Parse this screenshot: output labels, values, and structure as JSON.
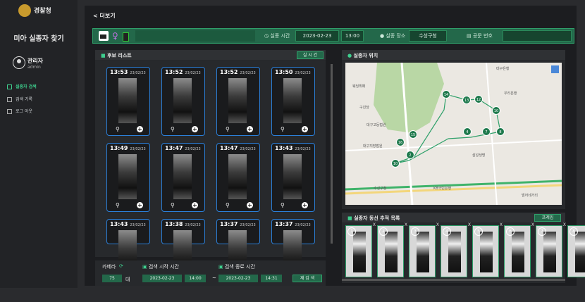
{
  "sidebar": {
    "logo_text": "경찰청",
    "app_title": "미아 실종자 찾기",
    "user": {
      "name": "관리자",
      "role": "admin"
    },
    "nav": [
      {
        "label": "실종자 검색",
        "active": true
      },
      {
        "label": "검색 기록",
        "active": false
      },
      {
        "label": "로그 아웃",
        "active": false
      }
    ]
  },
  "header": {
    "back": "< 더보기"
  },
  "topbar": {
    "time_label": "실종 시간",
    "date": "2023-02-23",
    "time": "13:00",
    "place_label": "실종 장소",
    "place": "수성구청",
    "doc_label": "공문 번호",
    "doc_value": ""
  },
  "candidates": {
    "title": "후보 리스트",
    "button": "실 시 간",
    "cards": [
      {
        "time": "13:53",
        "date": "23/02/23"
      },
      {
        "time": "13:52",
        "date": "23/02/23"
      },
      {
        "time": "13:52",
        "date": "23/02/23"
      },
      {
        "time": "13:50",
        "date": "23/02/23"
      },
      {
        "time": "13:49",
        "date": "23/02/23"
      },
      {
        "time": "13:47",
        "date": "23/02/23"
      },
      {
        "time": "13:47",
        "date": "23/02/23"
      },
      {
        "time": "13:43",
        "date": "23/02/23"
      },
      {
        "time": "13:43",
        "date": "23/02/23"
      },
      {
        "time": "13:38",
        "date": "23/02/23"
      },
      {
        "time": "13:37",
        "date": "23/02/23"
      },
      {
        "time": "13:37",
        "date": "23/02/23"
      }
    ]
  },
  "search": {
    "camera_label": "카메라",
    "camera_count": "75",
    "camera_unit": "대",
    "start_label": "검색 시작 시간",
    "start_date": "2023-02-23",
    "start_time": "14:00",
    "sep": "~",
    "end_label": "검색 종료 시간",
    "end_date": "2023-02-23",
    "end_time": "14:31",
    "research_button": "재 검 색"
  },
  "location": {
    "title": "실종자 위치",
    "markers": [
      "14",
      "13",
      "12",
      "10",
      "4",
      "7",
      "8",
      "15",
      "16",
      "10",
      "2"
    ],
    "map_labels": [
      "대구은행",
      "웨딩뷔페",
      "구진당",
      "우리은행",
      "대구고등법원",
      "대구지방법원",
      "삼성생명",
      "수성구청",
      "KB국민은행",
      "범어네거리"
    ]
  },
  "tracking": {
    "title": "실종자 동선 추적 목록",
    "button": "프레임",
    "items": [
      "1",
      "2",
      "3",
      "4",
      "5",
      "6",
      "7",
      "8"
    ]
  },
  "colors": {
    "accent": "#2fa06a",
    "card_border": "#2b7fd8",
    "bg": "#1c1d20"
  }
}
